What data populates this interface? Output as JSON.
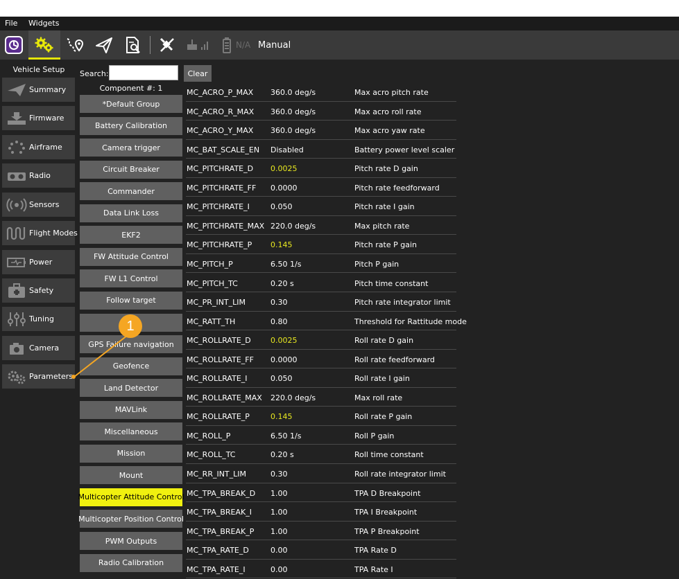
{
  "menubar": {
    "file": "File",
    "widgets": "Widgets"
  },
  "toolbar": {
    "icons": [
      "qgc-logo-icon",
      "setup-gear-icon",
      "plan-route-icon",
      "fly-send-icon",
      "analyze-icon",
      "no-gps-icon",
      "radio-signal-icon",
      "battery-icon"
    ],
    "battery_text": "N/A",
    "flight_mode": "Manual",
    "accent_color": "#e6e60a"
  },
  "sidebar": {
    "title": "Vehicle Setup",
    "items": [
      {
        "label": "Summary",
        "icon": "paper-plane-icon"
      },
      {
        "label": "Firmware",
        "icon": "download-icon"
      },
      {
        "label": "Airframe",
        "icon": "airframe-dots-icon"
      },
      {
        "label": "Radio",
        "icon": "radio-icon"
      },
      {
        "label": "Sensors",
        "icon": "sensors-icon"
      },
      {
        "label": "Flight Modes",
        "icon": "flight-modes-icon"
      },
      {
        "label": "Power",
        "icon": "power-battery-icon"
      },
      {
        "label": "Safety",
        "icon": "safety-kit-icon"
      },
      {
        "label": "Tuning",
        "icon": "tuning-sliders-icon"
      },
      {
        "label": "Camera",
        "icon": "camera-icon"
      },
      {
        "label": "Parameters",
        "icon": "parameters-gears-icon"
      }
    ]
  },
  "search": {
    "label": "Search:",
    "value": "",
    "clear_label": "Clear"
  },
  "groups": {
    "component_label": "Component #: 1",
    "items": [
      "*Default Group",
      "Battery Calibration",
      "Camera trigger",
      "Circuit Breaker",
      "Commander",
      "Data Link Loss",
      "EKF2",
      "FW Attitude Control",
      "FW L1 Control",
      "Follow target",
      "",
      "GPS Failure navigation",
      "Geofence",
      "Land Detector",
      "MAVLink",
      "Miscellaneous",
      "Mission",
      "Mount",
      "Multicopter Attitude Control",
      "Multicopter Position Control",
      "PWM Outputs",
      "Radio Calibration"
    ],
    "active_index": 18,
    "active_color": "#f0f00f"
  },
  "params": [
    {
      "name": "MC_ACRO_P_MAX",
      "value": "360.0 deg/s",
      "desc": "Max acro pitch rate",
      "modified": false
    },
    {
      "name": "MC_ACRO_R_MAX",
      "value": "360.0 deg/s",
      "desc": "Max acro roll rate",
      "modified": false
    },
    {
      "name": "MC_ACRO_Y_MAX",
      "value": "360.0 deg/s",
      "desc": "Max acro yaw rate",
      "modified": false
    },
    {
      "name": "MC_BAT_SCALE_EN",
      "value": "Disabled",
      "desc": "Battery power level scaler",
      "modified": false
    },
    {
      "name": "MC_PITCHRATE_D",
      "value": "0.0025",
      "desc": "Pitch rate D gain",
      "modified": true
    },
    {
      "name": "MC_PITCHRATE_FF",
      "value": "0.0000",
      "desc": "Pitch rate feedforward",
      "modified": false
    },
    {
      "name": "MC_PITCHRATE_I",
      "value": "0.050",
      "desc": "Pitch rate I gain",
      "modified": false
    },
    {
      "name": "MC_PITCHRATE_MAX",
      "value": "220.0 deg/s",
      "desc": "Max pitch rate",
      "modified": false
    },
    {
      "name": "MC_PITCHRATE_P",
      "value": "0.145",
      "desc": "Pitch rate P gain",
      "modified": true
    },
    {
      "name": "MC_PITCH_P",
      "value": "6.50 1/s",
      "desc": "Pitch P gain",
      "modified": false
    },
    {
      "name": "MC_PITCH_TC",
      "value": "0.20 s",
      "desc": "Pitch time constant",
      "modified": false
    },
    {
      "name": "MC_PR_INT_LIM",
      "value": "0.30",
      "desc": "Pitch rate integrator limit",
      "modified": false
    },
    {
      "name": "MC_RATT_TH",
      "value": "0.80",
      "desc": "Threshold for Rattitude mode",
      "modified": false
    },
    {
      "name": "MC_ROLLRATE_D",
      "value": "0.0025",
      "desc": "Roll rate D gain",
      "modified": true
    },
    {
      "name": "MC_ROLLRATE_FF",
      "value": "0.0000",
      "desc": "Roll rate feedforward",
      "modified": false
    },
    {
      "name": "MC_ROLLRATE_I",
      "value": "0.050",
      "desc": "Roll rate I gain",
      "modified": false
    },
    {
      "name": "MC_ROLLRATE_MAX",
      "value": "220.0 deg/s",
      "desc": "Max roll rate",
      "modified": false
    },
    {
      "name": "MC_ROLLRATE_P",
      "value": "0.145",
      "desc": "Roll rate P gain",
      "modified": true
    },
    {
      "name": "MC_ROLL_P",
      "value": "6.50 1/s",
      "desc": "Roll P gain",
      "modified": false
    },
    {
      "name": "MC_ROLL_TC",
      "value": "0.20 s",
      "desc": "Roll time constant",
      "modified": false
    },
    {
      "name": "MC_RR_INT_LIM",
      "value": "0.30",
      "desc": "Roll rate integrator limit",
      "modified": false
    },
    {
      "name": "MC_TPA_BREAK_D",
      "value": "1.00",
      "desc": "TPA D Breakpoint",
      "modified": false
    },
    {
      "name": "MC_TPA_BREAK_I",
      "value": "1.00",
      "desc": "TPA I Breakpoint",
      "modified": false
    },
    {
      "name": "MC_TPA_BREAK_P",
      "value": "1.00",
      "desc": "TPA P Breakpoint",
      "modified": false
    },
    {
      "name": "MC_TPA_RATE_D",
      "value": "0.00",
      "desc": "TPA Rate D",
      "modified": false
    },
    {
      "name": "MC_TPA_RATE_I",
      "value": "0.00",
      "desc": "TPA Rate I",
      "modified": false
    }
  ],
  "callout": {
    "number": "1",
    "color": "#f5a623"
  }
}
